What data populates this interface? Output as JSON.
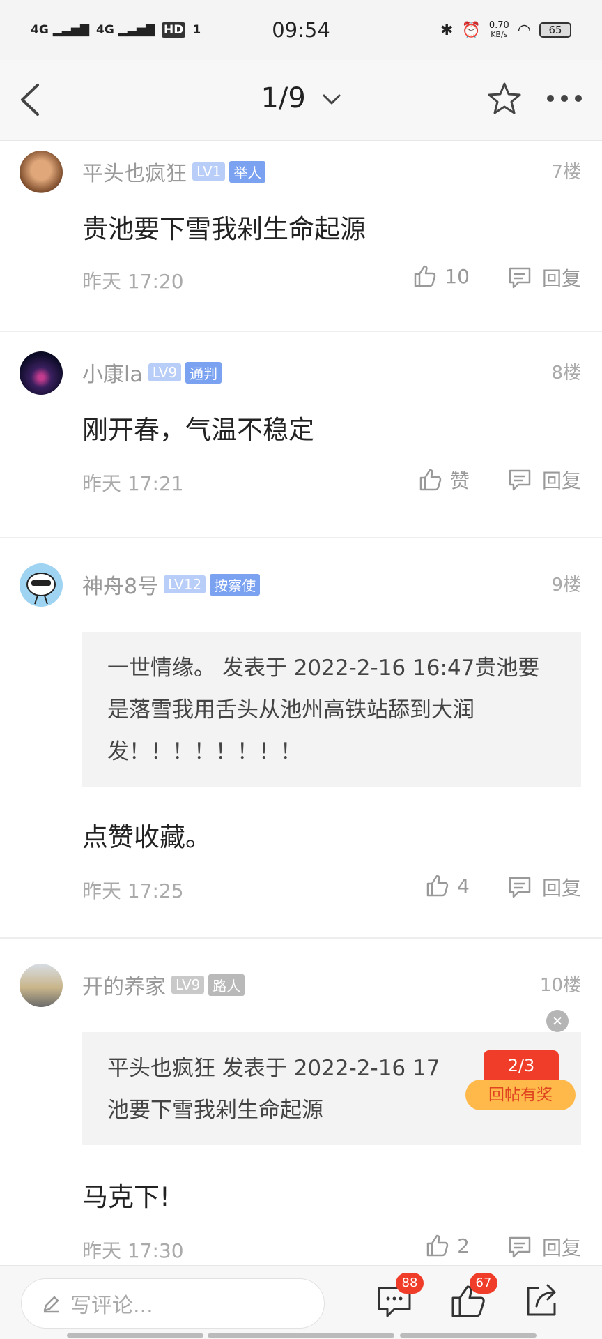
{
  "status_bar": {
    "signal1": "4G",
    "signal2": "4G",
    "hd": "HD",
    "hd_sub": "1",
    "time": "09:54",
    "net_speed": "0.70",
    "net_unit": "KB/s",
    "battery": "65"
  },
  "nav": {
    "page_indicator": "1/9",
    "icons": [
      "back-arrow-icon",
      "chevron-down-icon",
      "star-icon",
      "more-icon"
    ]
  },
  "posts": [
    {
      "username": "平头也疯狂",
      "level": "LV1",
      "title_badge": "举人",
      "floor": "7楼",
      "content": "贵池要下雪我剁生命起源",
      "time": "昨天 17:20",
      "likes": "10",
      "reply_label": "回复"
    },
    {
      "username": "小康la",
      "level": "LV9",
      "title_badge": "通判",
      "floor": "8楼",
      "content": "刚开春，气温不稳定",
      "time": "昨天 17:21",
      "likes": "赞",
      "reply_label": "回复"
    },
    {
      "username": "神舟8号",
      "level": "LV12",
      "title_badge": "按察使",
      "floor": "9楼",
      "quote": "一世情缘。 发表于 2022-2-16 16:47贵池要是落雪我用舌头从池州高铁站舔到大润发！！！！！！！！",
      "content": "点赞收藏。",
      "time": "昨天 17:25",
      "likes": "4",
      "reply_label": "回复"
    },
    {
      "username": "开的养家",
      "level": "LV9",
      "title_badge": "路人",
      "floor": "10楼",
      "quote": "平头也疯狂 发表于 2022-2-16 17",
      "quote_line2": "池要下雪我剁生命起源",
      "content": "马克下!",
      "time": "昨天 17:30",
      "likes": "2",
      "reply_label": "回复"
    }
  ],
  "promo": {
    "count": "2/3",
    "label": "回帖有奖",
    "close": "✕"
  },
  "bottom_bar": {
    "comment_placeholder": "写评论...",
    "comments_badge": "88",
    "likes_badge": "67"
  },
  "colors": {
    "level_badge": "#b8cdf7",
    "title_badge": "#7aa2f0",
    "red_badge": "#f03d2a",
    "promo_orange": "#ffb84a"
  }
}
